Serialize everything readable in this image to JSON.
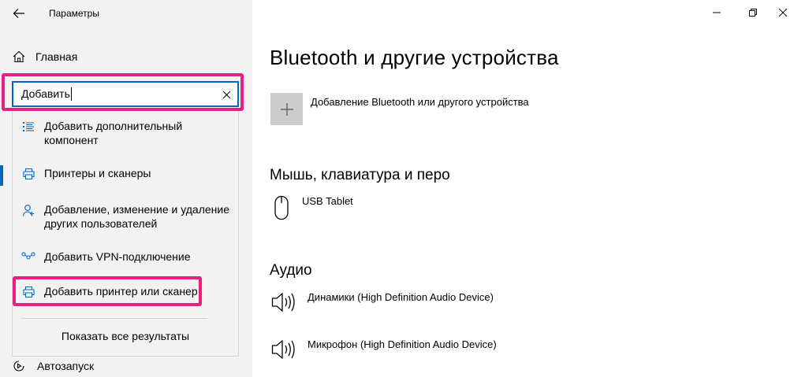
{
  "window": {
    "title": "Параметры"
  },
  "nav": {
    "home_label": "Главная",
    "autorun_label": "Автозапуск"
  },
  "search": {
    "value": "Добавить"
  },
  "suggestions": [
    {
      "icon": "list-icon",
      "label": "Добавить дополнительный компонент"
    },
    {
      "icon": "printer-icon",
      "label": "Принтеры и сканеры"
    },
    {
      "icon": "user-add-icon",
      "label": "Добавление, изменение и удаление других пользователей"
    },
    {
      "icon": "vpn-icon",
      "label": "Добавить VPN-подключение"
    },
    {
      "icon": "printer-icon",
      "label": "Добавить принтер или сканер"
    }
  ],
  "show_all_label": "Показать все результаты",
  "main": {
    "title": "Bluetooth и другие устройства",
    "add_device_label": "Добавление Bluetooth или другого устройства",
    "sections": {
      "mouse": "Мышь, клавиатура и перо",
      "audio": "Аудио"
    },
    "devices": {
      "tablet": "USB Tablet",
      "speakers": "Динамики (High Definition Audio Device)",
      "mic": "Микрофон (High Definition Audio Device)"
    }
  },
  "colors": {
    "accent": "#0067c0",
    "highlight": "#ea1e83"
  }
}
